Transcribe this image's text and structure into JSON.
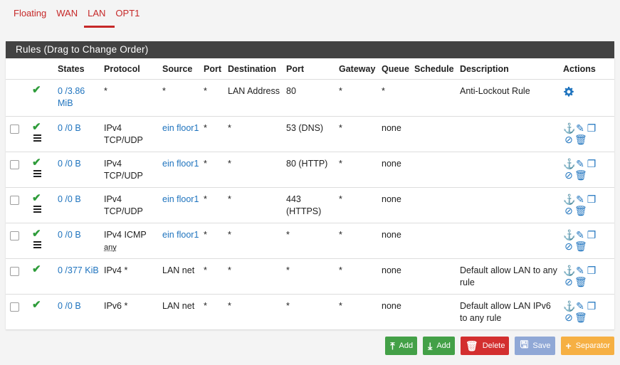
{
  "tabs": [
    {
      "label": "Floating"
    },
    {
      "label": "WAN"
    },
    {
      "label": "LAN",
      "active": true
    },
    {
      "label": "OPT1"
    }
  ],
  "panel": {
    "title": "Rules (Drag to Change Order)"
  },
  "columns": [
    "",
    "",
    "States",
    "Protocol",
    "Source",
    "Port",
    "Destination",
    "Port",
    "Gateway",
    "Queue",
    "Schedule",
    "Description",
    "Actions"
  ],
  "rows": [
    {
      "states": "0 /3.86 MiB",
      "protocol": "*",
      "protocol_sub": "",
      "source": "*",
      "src_port": "*",
      "destination": "LAN Address",
      "dst_port": "80",
      "gateway": "*",
      "queue": "*",
      "schedule": "",
      "description": "Anti-Lockout Rule"
    },
    {
      "states": "0 /0 B",
      "protocol": "IPv4 TCP/UDP",
      "protocol_sub": "",
      "source": "ein floor1",
      "src_port": "*",
      "destination": "*",
      "dst_port": "53 (DNS)",
      "gateway": "*",
      "queue": "none",
      "schedule": "",
      "description": ""
    },
    {
      "states": "0 /0 B",
      "protocol": "IPv4 TCP/UDP",
      "protocol_sub": "",
      "source": "ein floor1",
      "src_port": "*",
      "destination": "*",
      "dst_port": "80 (HTTP)",
      "gateway": "*",
      "queue": "none",
      "schedule": "",
      "description": ""
    },
    {
      "states": "0 /0 B",
      "protocol": "IPv4 TCP/UDP",
      "protocol_sub": "",
      "source": "ein floor1",
      "src_port": "*",
      "destination": "*",
      "dst_port": "443 (HTTPS)",
      "gateway": "*",
      "queue": "none",
      "schedule": "",
      "description": ""
    },
    {
      "states": "0 /0 B",
      "protocol": "IPv4 ICMP",
      "protocol_sub": "any",
      "source": "ein floor1",
      "src_port": "*",
      "destination": "*",
      "dst_port": "*",
      "gateway": "*",
      "queue": "none",
      "schedule": "",
      "description": ""
    },
    {
      "states": "0 /377 KiB",
      "protocol": "IPv4 *",
      "protocol_sub": "",
      "source": "LAN net",
      "src_port": "*",
      "destination": "*",
      "dst_port": "*",
      "gateway": "*",
      "queue": "none",
      "schedule": "",
      "description": "Default allow LAN to any rule"
    },
    {
      "states": "0 /0 B",
      "protocol": "IPv6 *",
      "protocol_sub": "",
      "source": "LAN net",
      "src_port": "*",
      "destination": "*",
      "dst_port": "*",
      "gateway": "*",
      "queue": "none",
      "schedule": "",
      "description": "Default allow LAN IPv6 to any rule"
    }
  ],
  "buttons": {
    "add_top": "Add",
    "add_bottom": "Add",
    "delete": "Delete",
    "save": "Save",
    "separator": "Separator"
  },
  "colors": {
    "accent": "#c62828",
    "link": "#1e73be",
    "success": "#43a047",
    "danger": "#d32f2f",
    "save": "#90a8d6",
    "warning": "#f6b043"
  }
}
